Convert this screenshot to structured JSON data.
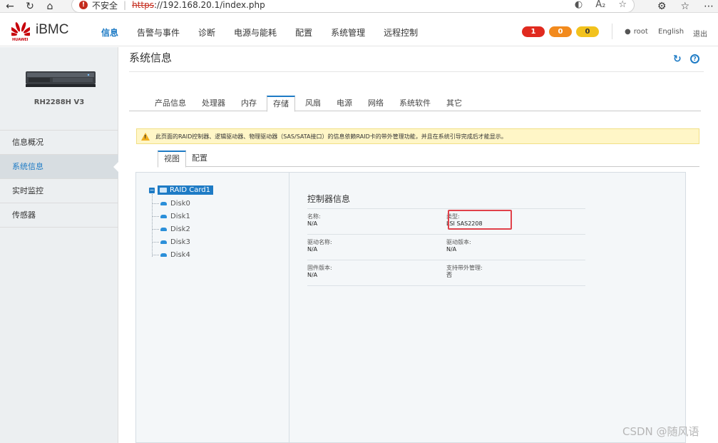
{
  "browser": {
    "insecure_label": "不安全",
    "url_scheme": "https",
    "url_rest": "://192.168.20.1/index.php"
  },
  "header": {
    "brand": "iBMC",
    "logo_text": "HUAWEI",
    "nav": [
      "信息",
      "告警与事件",
      "诊断",
      "电源与能耗",
      "配置",
      "系统管理",
      "远程控制"
    ],
    "alarms": {
      "critical": "1",
      "major": "0",
      "minor": "0"
    },
    "user": "root",
    "language": "English",
    "logout": "退出"
  },
  "sidebar": {
    "model": "RH2288H V3",
    "items": [
      "信息概况",
      "系统信息",
      "实时监控",
      "传感器"
    ]
  },
  "main": {
    "title": "系统信息",
    "tabs": [
      "产品信息",
      "处理器",
      "内存",
      "存储",
      "风扇",
      "电源",
      "网络",
      "系统软件",
      "其它"
    ],
    "notice": "此页面的RAID控制器、逻辑驱动器、物理驱动器（SAS/SATA接口）的信息依赖RAID卡的带外管理功能，并且在系统引导完成后才能显示。",
    "subtabs": [
      "视图",
      "配置"
    ]
  },
  "tree": {
    "root": "RAID Card1",
    "children": [
      "Disk0",
      "Disk1",
      "Disk2",
      "Disk3",
      "Disk4"
    ]
  },
  "controller": {
    "title": "控制器信息",
    "name_label": "名称:",
    "name_value": "N/A",
    "type_label": "类型:",
    "type_value": "LSI SAS2208",
    "driver_name_label": "驱动名称:",
    "driver_name_value": "N/A",
    "driver_version_label": "驱动版本:",
    "driver_version_value": "N/A",
    "firmware_label": "固件版本:",
    "firmware_value": "N/A",
    "oob_label": "支持带外管理:",
    "oob_value": "否"
  },
  "watermark": "CSDN @随风语",
  "colors": {
    "accent": "#1e7bc5",
    "critical": "#e02a1f",
    "major": "#f28a1d",
    "minor": "#f2c21d",
    "notice_bg": "#fff6c7"
  }
}
